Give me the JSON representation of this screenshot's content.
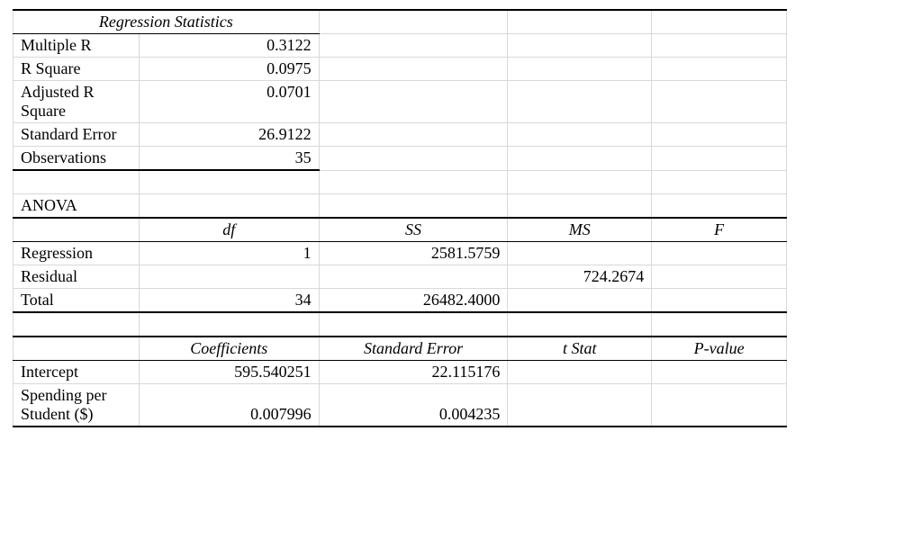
{
  "title": "Regression Statistics",
  "stats": {
    "multiple_r_label": "Multiple R",
    "multiple_r": "0.3122",
    "r_square_label": "R Square",
    "r_square": "0.0975",
    "adj_r_square_label": "Adjusted R Square",
    "adj_r_square": "0.0701",
    "std_error_label": "Standard Error",
    "std_error": "26.9122",
    "observations_label": "Observations",
    "observations": "35"
  },
  "anova": {
    "label": "ANOVA",
    "headers": {
      "df": "df",
      "ss": "SS",
      "ms": "MS",
      "f": "F"
    },
    "rows": {
      "regression": {
        "label": "Regression",
        "df": "1",
        "ss": "2581.5759",
        "ms": "",
        "f": ""
      },
      "residual": {
        "label": "Residual",
        "df": "",
        "ss": "",
        "ms": "724.2674",
        "f": ""
      },
      "total": {
        "label": "Total",
        "df": "34",
        "ss": "26482.4000",
        "ms": "",
        "f": ""
      }
    }
  },
  "coef": {
    "headers": {
      "coef": "Coefficients",
      "se": "Standard Error",
      "tstat": "t Stat",
      "pvalue": "P-value"
    },
    "rows": {
      "intercept": {
        "label": "Intercept",
        "coef": "595.540251",
        "se": "22.115176",
        "tstat": "",
        "pvalue": ""
      },
      "spending": {
        "label": "Spending per Student ($)",
        "coef": "0.007996",
        "se": "0.004235",
        "tstat": "",
        "pvalue": ""
      }
    }
  },
  "chart_data": {
    "type": "table",
    "title": "Regression Statistics",
    "regression_statistics": {
      "Multiple R": 0.3122,
      "R Square": 0.0975,
      "Adjusted R Square": 0.0701,
      "Standard Error": 26.9122,
      "Observations": 35
    },
    "anova": [
      {
        "source": "Regression",
        "df": 1,
        "SS": 2581.5759,
        "MS": null,
        "F": null
      },
      {
        "source": "Residual",
        "df": null,
        "SS": null,
        "MS": 724.2674,
        "F": null
      },
      {
        "source": "Total",
        "df": 34,
        "SS": 26482.4,
        "MS": null,
        "F": null
      }
    ],
    "coefficients": [
      {
        "term": "Intercept",
        "Coefficients": 595.540251,
        "Standard Error": 22.115176,
        "t Stat": null,
        "P-value": null
      },
      {
        "term": "Spending per Student ($)",
        "Coefficients": 0.007996,
        "Standard Error": 0.004235,
        "t Stat": null,
        "P-value": null
      }
    ]
  }
}
